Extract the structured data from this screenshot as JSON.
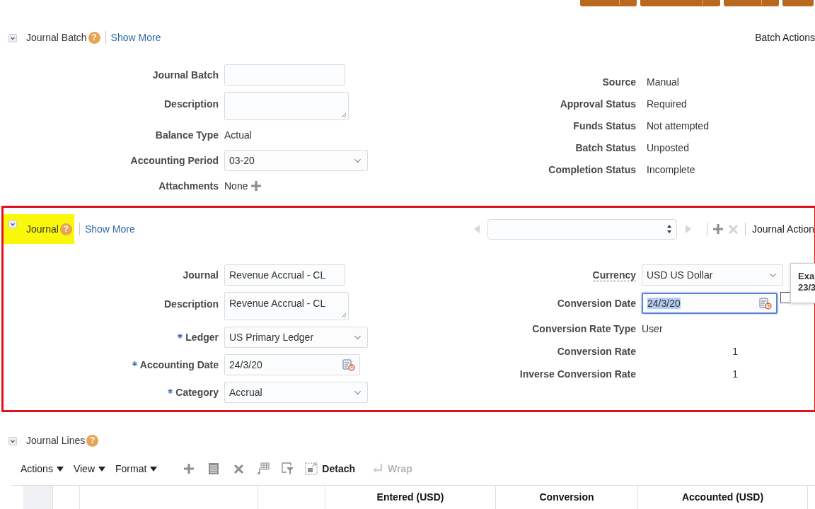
{
  "header_buttons": [
    {
      "kind": "split"
    },
    {
      "kind": "split"
    },
    {
      "kind": "split"
    },
    {
      "kind": "plain"
    }
  ],
  "batch": {
    "title": "Journal Batch",
    "help": "?",
    "show_more": "Show More",
    "actions": "Batch Actions",
    "fields": [
      {
        "label": "Journal Batch",
        "kind": "text",
        "required": false
      },
      {
        "label": "Description",
        "kind": "textarea",
        "required": false
      },
      {
        "label": "Balance Type",
        "kind": "static",
        "value": "Actual",
        "required": false
      },
      {
        "label": "Accounting Period",
        "kind": "select",
        "value": "03-20",
        "required": false
      },
      {
        "label": "Attachments",
        "kind": "attachments",
        "value": "None",
        "required": false
      }
    ],
    "status": [
      {
        "label": "Source",
        "value": "Manual"
      },
      {
        "label": "Approval Status",
        "value": "Required"
      },
      {
        "label": "Funds Status",
        "value": "Not attempted"
      },
      {
        "label": "Batch Status",
        "value": "Unposted"
      },
      {
        "label": "Completion Status",
        "value": "Incomplete"
      }
    ]
  },
  "journal": {
    "title": "Journal",
    "help": "?",
    "highlighted": true,
    "show_more": "Show More",
    "actions": "Journal Action",
    "fields": [
      {
        "label": "Journal",
        "kind": "text",
        "value": "Revenue Accrual - CL",
        "required": false
      },
      {
        "label": "Description",
        "kind": "textarea",
        "value": "Revenue Accrual - CL",
        "required": false
      },
      {
        "label": "Ledger",
        "kind": "select",
        "value": "US Primary Ledger",
        "required": true
      },
      {
        "label": "Accounting Date",
        "kind": "date",
        "value": "24/3/20",
        "required": true,
        "focused": false
      },
      {
        "label": "Category",
        "kind": "select",
        "value": "Accrual",
        "required": true
      }
    ],
    "currency_fields": [
      {
        "label": "Currency",
        "kind": "select",
        "value": "USD US Dollar",
        "underlined": true
      },
      {
        "label": "Conversion Date",
        "kind": "date",
        "value": "24/3/20",
        "focused": true,
        "underlined": false
      },
      {
        "label": "Conversion Rate Type",
        "kind": "static",
        "value": "User",
        "underlined": false
      },
      {
        "label": "Conversion Rate",
        "kind": "number",
        "value": "1",
        "underlined": false
      },
      {
        "label": "Inverse Conversion Rate",
        "kind": "number",
        "value": "1",
        "underlined": false
      }
    ],
    "tooltip": [
      "Exa",
      "23/3"
    ]
  },
  "lines": {
    "title": "Journal Lines",
    "help": "?",
    "menus": [
      "Actions",
      "View",
      "Format"
    ],
    "tools": [
      {
        "kind": "add"
      },
      {
        "kind": "details"
      },
      {
        "kind": "delete"
      },
      {
        "kind": "split"
      },
      {
        "kind": "filter"
      }
    ],
    "actions": [
      {
        "kind": "detach",
        "label": "Detach",
        "disabled": false
      },
      {
        "kind": "wrap",
        "label": "Wrap",
        "disabled": true
      }
    ],
    "columns": [
      {
        "kind": "selector"
      },
      {
        "kind": "blank"
      },
      {
        "kind": "blank"
      },
      {
        "kind": "blank"
      },
      {
        "kind": "text",
        "label": "Entered (USD)"
      },
      {
        "kind": "text",
        "label": "Conversion"
      },
      {
        "kind": "text",
        "label": "Accounted (USD)"
      }
    ]
  }
}
